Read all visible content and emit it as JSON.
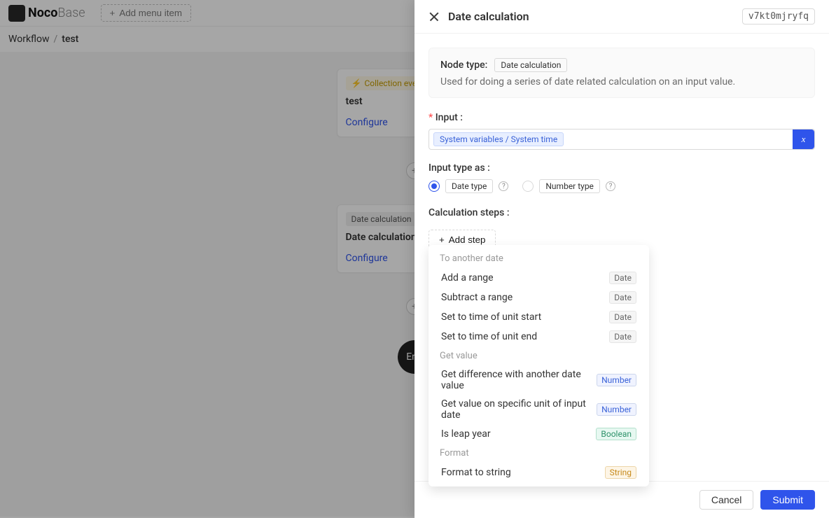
{
  "header": {
    "logoStrong": "Noco",
    "logoLight": "Base",
    "addMenu": "Add menu item"
  },
  "breadcrumb": {
    "workflow": "Workflow",
    "sep": "/",
    "current": "test"
  },
  "canvas": {
    "card1": {
      "tag": "Collection event",
      "title": "test",
      "link": "Configure"
    },
    "card2": {
      "tag": "Date calculation",
      "hash": "#",
      "title": "Date calculation",
      "link": "Configure"
    },
    "end": "End"
  },
  "drawer": {
    "title": "Date calculation",
    "id": "v7kt0mjryfq",
    "info": {
      "labelType": "Node type:",
      "typeTag": "Date calculation",
      "desc": "Used for doing a series of date related calculation on an input value."
    },
    "inputLabel": "Input :",
    "inputChip": "System variables / System time",
    "varBtn": "x",
    "typeAs": {
      "label": "Input type as :",
      "date": "Date type",
      "number": "Number type"
    },
    "stepsLabel": "Calculation steps :",
    "addStep": "Add step",
    "footer": {
      "cancel": "Cancel",
      "submit": "Submit"
    }
  },
  "dropdown": {
    "group1": "To another date",
    "items1": [
      {
        "label": "Add a range",
        "badge": "Date"
      },
      {
        "label": "Subtract a range",
        "badge": "Date"
      },
      {
        "label": "Set to time of unit start",
        "badge": "Date"
      },
      {
        "label": "Set to time of unit end",
        "badge": "Date"
      }
    ],
    "group2": "Get value",
    "items2": [
      {
        "label": "Get difference with another date value",
        "badge": "Number"
      },
      {
        "label": "Get value on specific unit of input date",
        "badge": "Number"
      },
      {
        "label": "Is leap year",
        "badge": "Boolean"
      }
    ],
    "group3": "Format",
    "items3": [
      {
        "label": "Format to string",
        "badge": "String"
      }
    ]
  }
}
